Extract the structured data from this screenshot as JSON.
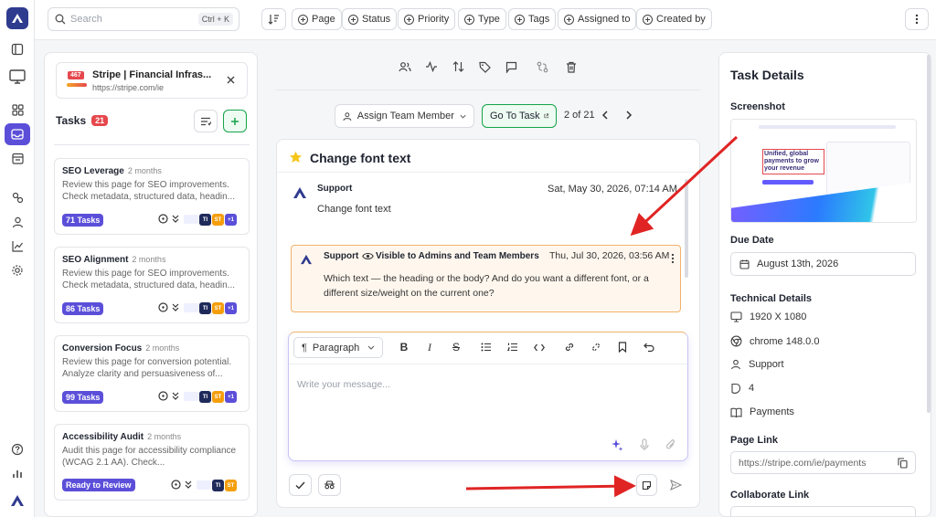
{
  "search": {
    "placeholder": "Search",
    "shortcut": "Ctrl + K"
  },
  "filters": [
    "Page",
    "Status",
    "Priority",
    "Type",
    "Tags",
    "Assigned to",
    "Created by"
  ],
  "site": {
    "badge": "467",
    "title": "Stripe | Financial Infras...",
    "url": "https://stripe.com/ie"
  },
  "tasks": {
    "label": "Tasks",
    "count": "21"
  },
  "task_cards": [
    {
      "title": "SEO Leverage",
      "age": "2 months",
      "desc": "Review this page for SEO improvements. Check metadata, structured data, headin...",
      "pill": "71 Tasks",
      "avatars": [
        "TI",
        "ST",
        "+1"
      ]
    },
    {
      "title": "SEO Alignment",
      "age": "2 months",
      "desc": "Review this page for SEO improvements. Check metadata, structured data, headin...",
      "pill": "86 Tasks",
      "avatars": [
        "TI",
        "ST",
        "+1"
      ]
    },
    {
      "title": "Conversion Focus",
      "age": "2 months",
      "desc": "Review this page for conversion potential. Analyze clarity and persuasiveness of...",
      "pill": "99 Tasks",
      "avatars": [
        "TI",
        "ST",
        "+1"
      ]
    },
    {
      "title": "Accessibility Audit",
      "age": "2 months",
      "desc": "Audit this page for accessibility compliance (WCAG 2.1 AA). Check...",
      "pill": "Ready to Review",
      "avatars": [
        "TI",
        "ST"
      ]
    }
  ],
  "assign": {
    "label": "Assign Team Member",
    "go": "Go To Task",
    "pager": "2 of 21"
  },
  "thread": {
    "title": "Change font text",
    "msg1": {
      "author": "Support",
      "time": "Sat, May 30, 2026, 07:14 AM",
      "text": "Change font text"
    },
    "msg2": {
      "author": "Support",
      "visibility": "Visible to Admins and Team Members",
      "time": "Thu, Jul 30, 2026, 03:56 AM",
      "text": "Which text — the heading or the body? And do you want a different font, or a different size/weight on the current one?"
    }
  },
  "editor": {
    "block": "Paragraph",
    "placeholder": "Write your message..."
  },
  "details": {
    "title": "Task Details",
    "screenshot_label": "Screenshot",
    "thumb_headline": "Unified, global payments to grow your revenue",
    "due_label": "Due Date",
    "due": "August 13th, 2026",
    "tech_label": "Technical Details",
    "resolution": "1920 X 1080",
    "browser": "chrome 148.0.0",
    "reporter": "Support",
    "count": "4",
    "page": "Payments",
    "link_label": "Page Link",
    "link": "https://stripe.com/ie/payments",
    "collab_label": "Collaborate Link"
  },
  "colors": {
    "accent": "#5b4fd9",
    "note_bg": "#fff7ee",
    "note_border": "#f3b26b",
    "arrow": "#e02424",
    "green": "#16a34a",
    "badge": "#e5484d"
  }
}
